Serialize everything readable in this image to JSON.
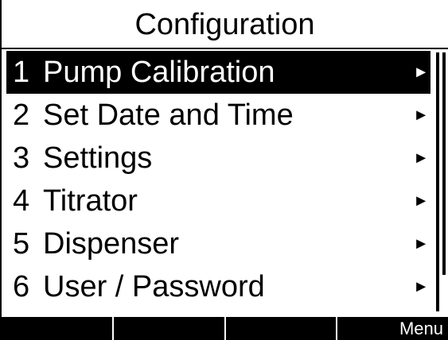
{
  "screen": {
    "title": "Configuration"
  },
  "menu": {
    "items": [
      {
        "num": "1",
        "label": "Pump Calibration",
        "arrow": "►",
        "selected": true
      },
      {
        "num": "2",
        "label": "Set Date and Time",
        "arrow": "►",
        "selected": false
      },
      {
        "num": "3",
        "label": "Settings",
        "arrow": "►",
        "selected": false
      },
      {
        "num": "4",
        "label": "Titrator",
        "arrow": "►",
        "selected": false
      },
      {
        "num": "5",
        "label": "Dispenser",
        "arrow": "►",
        "selected": false
      },
      {
        "num": "6",
        "label": "User / Password",
        "arrow": "►",
        "selected": false
      }
    ]
  },
  "softkeys": [
    "",
    "",
    "",
    "Menu"
  ],
  "colors": {
    "background": "#ffffff",
    "foreground": "#000000",
    "highlight": "#000000",
    "highlight_text": "#ffffff"
  }
}
